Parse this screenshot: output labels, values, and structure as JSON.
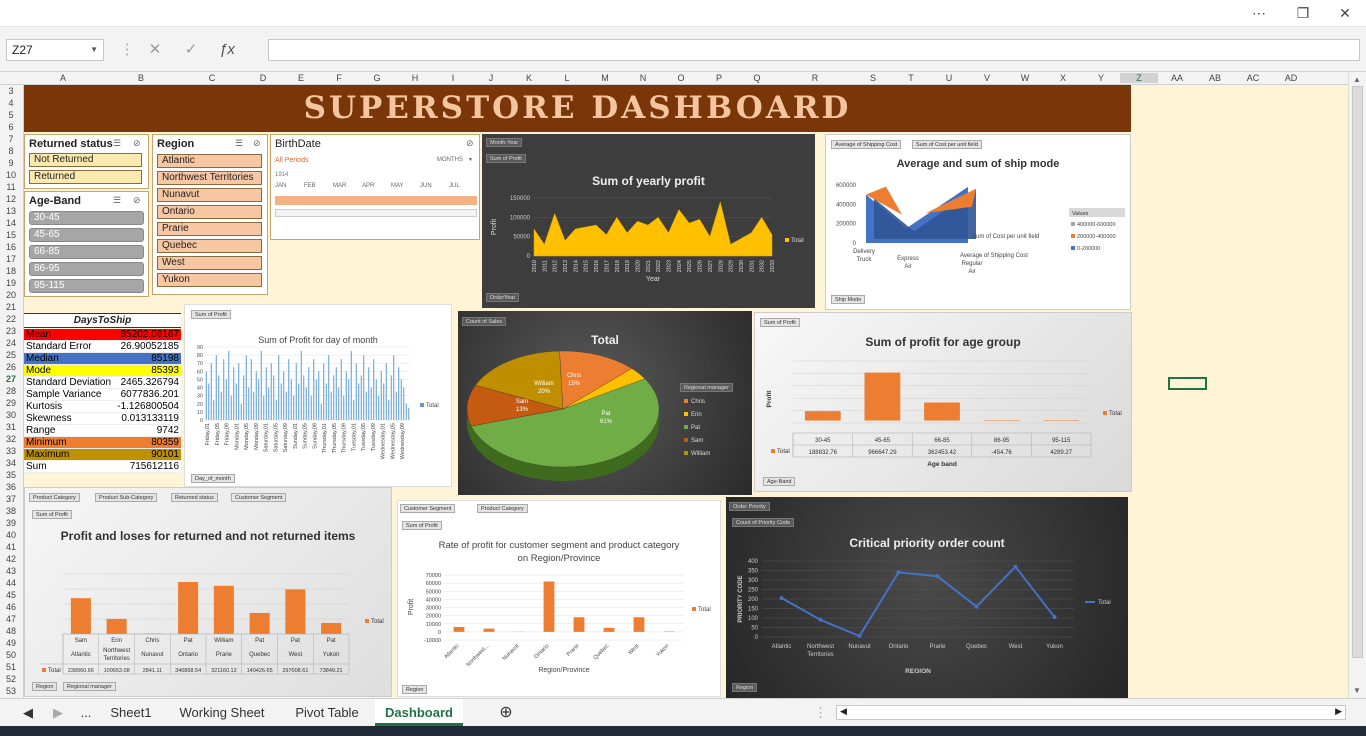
{
  "window": {
    "more_icon": "ellipsis-icon",
    "restore_icon": "restore-icon",
    "close_icon": "close-icon"
  },
  "formula_bar": {
    "name_box": "Z27",
    "formula": ""
  },
  "columns": [
    "A",
    "B",
    "C",
    "D",
    "E",
    "F",
    "G",
    "H",
    "I",
    "J",
    "K",
    "L",
    "M",
    "N",
    "O",
    "P",
    "Q",
    "R",
    "S",
    "T",
    "U",
    "V",
    "W",
    "X",
    "Y",
    "Z",
    "AA",
    "AB",
    "AC",
    "AD"
  ],
  "rows": [
    "3",
    "4",
    "5",
    "6",
    "7",
    "8",
    "9",
    "10",
    "11",
    "12",
    "13",
    "14",
    "15",
    "16",
    "17",
    "18",
    "19",
    "20",
    "21",
    "22",
    "23",
    "24",
    "25",
    "26",
    "27",
    "28",
    "29",
    "30",
    "31",
    "32",
    "33",
    "34",
    "35",
    "36",
    "37",
    "38",
    "39",
    "40",
    "41",
    "42",
    "43",
    "44",
    "45",
    "46",
    "47",
    "48",
    "49",
    "50",
    "51",
    "52",
    "53"
  ],
  "banner": {
    "title": "SUPERSTORE DASHBOARD"
  },
  "slicers": {
    "returned": {
      "title": "Returned status",
      "items": [
        "Not Returned",
        "Returned"
      ]
    },
    "age_band": {
      "title": "Age-Band",
      "items": [
        "30-45",
        "45-65",
        "66-85",
        "86-95",
        "95-115"
      ]
    },
    "region": {
      "title": "Region",
      "items": [
        "Atlantic",
        "Northwest Territories",
        "Nunavut",
        "Ontario",
        "Prarie",
        "Quebec",
        "West",
        "Yukon"
      ]
    },
    "birthdate": {
      "title": "BirthDate",
      "periods": "All Periods",
      "unit": "MONTHS",
      "year": "1914",
      "months": [
        "JAN",
        "FEB",
        "MAR",
        "APR",
        "MAY",
        "JUN",
        "JUL"
      ]
    }
  },
  "stats": {
    "title": "DaysToShip",
    "rows": [
      {
        "label": "Mean",
        "value": "85202.06167",
        "color": "#ff0000",
        "text": "#000"
      },
      {
        "label": "Standard Error",
        "value": "26.90052185",
        "color": "#ffffff",
        "text": "#000"
      },
      {
        "label": "Median",
        "value": "85198",
        "color": "#4472c4",
        "text": "#000"
      },
      {
        "label": "Mode",
        "value": "85393",
        "color": "#ffff00",
        "text": "#000"
      },
      {
        "label": "Standard Deviation",
        "value": "2465.326794",
        "color": "#ffffff",
        "text": "#000"
      },
      {
        "label": "Sample Variance",
        "value": "6077836.201",
        "color": "#ffffff",
        "text": "#000"
      },
      {
        "label": "Kurtosis",
        "value": "-1.126800504",
        "color": "#ffffff",
        "text": "#000"
      },
      {
        "label": "Skewness",
        "value": "0.013133119",
        "color": "#ffffff",
        "text": "#000"
      },
      {
        "label": "Range",
        "value": "9742",
        "color": "#ffffff",
        "text": "#000"
      },
      {
        "label": "Minimum",
        "value": "80359",
        "color": "#ed7d31",
        "text": "#000"
      },
      {
        "label": "Maximum",
        "value": "90101",
        "color": "#bf9000",
        "text": "#000"
      },
      {
        "label": "Sum",
        "value": "715612116",
        "color": "#ffffff",
        "text": "#000"
      }
    ]
  },
  "sheet_tabs": {
    "items": [
      "Sheet1",
      "Working Sheet",
      "Pivot Table",
      "Dashboard"
    ],
    "active": "Dashboard",
    "ellipsis": "..."
  },
  "chart_data": [
    {
      "id": "yearly",
      "type": "area",
      "title": "Sum of yearly profit",
      "buttons": [
        "Month-Year",
        "Sum of Profit",
        "OrderYear"
      ],
      "xlabel": "Year",
      "ylabel": "Profit",
      "x": [
        "2010",
        "2011",
        "2012",
        "2013",
        "2014",
        "2015",
        "2016",
        "2017",
        "2018",
        "2019",
        "2020",
        "2021",
        "2022",
        "2023",
        "2024",
        "2025",
        "2026",
        "2027",
        "2028",
        "2029",
        "2030",
        "2031",
        "2032",
        "2033"
      ],
      "series": [
        {
          "name": "Total",
          "values": [
            70000,
            30000,
            110000,
            40000,
            70000,
            75000,
            80000,
            55000,
            100000,
            60000,
            90000,
            80000,
            100000,
            60000,
            120000,
            85000,
            95000,
            50000,
            140000,
            30000,
            45000,
            60000,
            100000,
            55000
          ]
        }
      ],
      "ylim": [
        0,
        150000
      ],
      "yticks": [
        "0",
        "50000",
        "100000",
        "150000"
      ]
    },
    {
      "id": "shipmode",
      "type": "area",
      "title": "Average and sum of ship mode",
      "buttons": [
        "Average of Shipping Cost",
        "Sum of Cost per unit field",
        "Ship Mode"
      ],
      "categories": [
        "Delivery Truck",
        "Express Air",
        "Regular Air"
      ],
      "series": [
        {
          "name": "Sum of Cost per unit field",
          "values": [
            500000,
            150000,
            580000
          ]
        },
        {
          "name": "Average of Shipping Cost",
          "values": [
            420000,
            80000,
            520000
          ]
        }
      ],
      "legend_title": "Values",
      "legend": [
        "400000-600000",
        "200000-400000",
        "0-200000"
      ],
      "ylim": [
        0,
        600000
      ],
      "yticks": [
        "0",
        "200000",
        "400000",
        "600000"
      ]
    },
    {
      "id": "daymonth",
      "type": "bar",
      "title": "Sum of Profit for day of month",
      "buttons": [
        "Sum of Profit",
        "Day_of_month"
      ],
      "x_labels": [
        "Friday,01",
        "Friday,05",
        "Friday,09",
        "Monday,01",
        "Monday,05",
        "Monday,09",
        "Saturday,01",
        "Saturday,05",
        "Saturday,09",
        "Sunday,01",
        "Sunday,05",
        "Sunday,09",
        "Thursday,01",
        "Thursday,05",
        "Thursday,09",
        "Tuesday,01",
        "Tuesday,05",
        "Tuesday,09",
        "Wednesday,01",
        "Wednesday,05",
        "Wednesday,09"
      ],
      "series": [
        {
          "name": "Total",
          "values": [
            60,
            45,
            70,
            25,
            80,
            55,
            35,
            75,
            50,
            85,
            30,
            65,
            45,
            70,
            20,
            55,
            80,
            40,
            75,
            35,
            60,
            50,
            85,
            30,
            65,
            40,
            70,
            55,
            25,
            80,
            45,
            60,
            35,
            75,
            50,
            30,
            70,
            45,
            85,
            55,
            40,
            65,
            30,
            75,
            50,
            60,
            20,
            70,
            45,
            80,
            35,
            55,
            65,
            40,
            75,
            30,
            60,
            50,
            85,
            25,
            70,
            45,
            55,
            80,
            35,
            65,
            40,
            75,
            50,
            30,
            60,
            45,
            70,
            25,
            55,
            80,
            35,
            65,
            50,
            40,
            20,
            15
          ]
        }
      ],
      "ylim": [
        0,
        90
      ],
      "yticks": [
        "0",
        "10",
        "20",
        "30",
        "40",
        "50",
        "60",
        "70",
        "80",
        "90"
      ]
    },
    {
      "id": "pie",
      "type": "pie",
      "title": "Total",
      "buttons": [
        "Count of Sales",
        "Regional manager"
      ],
      "slices": [
        {
          "name": "Chris",
          "value": 15,
          "color": "#ed7d31"
        },
        {
          "name": "Erin",
          "value": 4,
          "color": "#ffc000"
        },
        {
          "name": "Pat",
          "value": 61,
          "color": "#70ad47"
        },
        {
          "name": "Sam",
          "value": 13,
          "color": "#c55a11"
        },
        {
          "name": "William",
          "value": 20,
          "color": "#bf8f00"
        }
      ],
      "labels": [
        {
          "name": "Pat",
          "pct": "61%"
        },
        {
          "name": "Sam",
          "pct": "13%"
        },
        {
          "name": "William",
          "pct": "20%"
        },
        {
          "name": "Chris",
          "pct": "15%"
        }
      ]
    },
    {
      "id": "agegroup",
      "type": "bar",
      "title": "Sum of profit for age group",
      "buttons": [
        "Sum of Profit",
        "Age-Band"
      ],
      "categories": [
        "30-45",
        "45-65",
        "66-85",
        "86-95",
        "95-115"
      ],
      "series": [
        {
          "name": "Total",
          "values": [
            188832.76,
            966647.29,
            362453.42,
            -454.76,
            4289.27
          ]
        }
      ],
      "value_labels": [
        "188832.76",
        "966647.29",
        "362453.42",
        "-454.76",
        "4289.27"
      ],
      "xlabel": "Age band",
      "ylabel": "Profit",
      "ylim": [
        -50000,
        1200000
      ]
    },
    {
      "id": "returned",
      "type": "bar",
      "title": "Profit and loses for returned and not returned items",
      "buttons": [
        "Product Category",
        "Product Sub-Category",
        "Returned status",
        "Customer Segment",
        "Sum of Profit",
        "Region",
        "Regional manager"
      ],
      "managers": [
        "Sam",
        "Erin",
        "Chris",
        "Pat",
        "William",
        "Pat",
        "Pat",
        "Pat"
      ],
      "categories": [
        "Atlantic",
        "Northwest Territories",
        "Nunavut",
        "Ontario",
        "Prarie",
        "Quebec",
        "West",
        "Yukon"
      ],
      "series": [
        {
          "name": "Total",
          "values": [
            238960.66,
            100653.08,
            2841.11,
            346868.54,
            321160.12,
            140426.65,
            297008.61,
            73849.21
          ]
        }
      ],
      "value_labels": [
        "238960.66",
        "100653.08",
        "2841.11",
        "346868.54",
        "321160.12",
        "140426.65",
        "297008.61",
        "73849.21"
      ],
      "ylim": [
        0,
        400000
      ]
    },
    {
      "id": "segment",
      "type": "bar",
      "title": "Rate of profit for customer segment and product category on Region/Province",
      "buttons": [
        "Customer Segment",
        "Product Category",
        "Sum of Profit",
        "Region"
      ],
      "categories": [
        "Atlantic",
        "Northwest...",
        "Nunavut",
        "Ontario",
        "Prarie",
        "Quebec",
        "West",
        "Yukon"
      ],
      "series": [
        {
          "name": "Total",
          "values": [
            6000,
            4000,
            200,
            62000,
            18000,
            5000,
            18000,
            500
          ]
        }
      ],
      "xlabel": "Region/Province",
      "ylabel": "Profit",
      "ylim": [
        -10000,
        70000
      ],
      "yticks": [
        "-10000",
        "0",
        "10000",
        "20000",
        "30000",
        "40000",
        "50000",
        "60000",
        "70000"
      ]
    },
    {
      "id": "priority",
      "type": "line",
      "title": "Critical priority order count",
      "buttons": [
        "Order Priority",
        "Count of Priority Code",
        "Region"
      ],
      "categories": [
        "Atlantic",
        "Northwest Territories",
        "Nunavut",
        "Ontario",
        "Prarie",
        "Quebec",
        "West",
        "Yukon"
      ],
      "series": [
        {
          "name": "Total",
          "values": [
            205,
            90,
            5,
            340,
            320,
            160,
            370,
            105
          ]
        }
      ],
      "xlabel": "REGION",
      "ylabel": "PRIORITY CODE",
      "ylim": [
        0,
        400
      ],
      "yticks": [
        "0",
        "50",
        "100",
        "150",
        "200",
        "250",
        "300",
        "350",
        "400"
      ]
    }
  ]
}
